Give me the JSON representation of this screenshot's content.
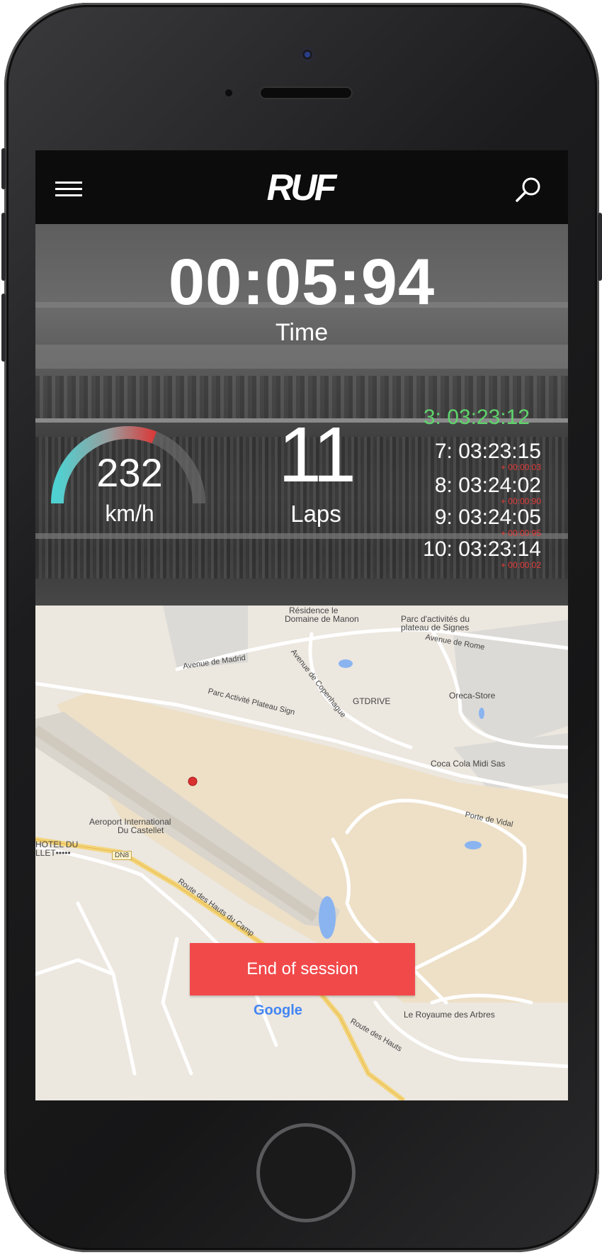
{
  "app": {
    "logo_text": "RUF",
    "menu_icon": "hamburger-menu-icon",
    "search_icon": "search-icon"
  },
  "session": {
    "time": "00:05:94",
    "time_label": "Time",
    "speed": "232",
    "speed_unit": "km/h",
    "speed_gauge_fraction": 0.62,
    "laps": "11",
    "laps_label": "Laps"
  },
  "lap_times": {
    "best": "3: 03:23:12",
    "others": [
      {
        "time": "7: 03:23:15",
        "delta": "+ 00:00:03"
      },
      {
        "time": "8: 03:24:02",
        "delta": "+ 00:00:90"
      },
      {
        "time": "9: 03:24:05",
        "delta": "+ 00:00:95"
      },
      {
        "time": "10: 03:23:14",
        "delta": "+ 00:00:02"
      }
    ]
  },
  "map": {
    "labels": {
      "residence": "Résidence le",
      "residence2": "Domaine de Manon",
      "parc_signes": "Parc d'activités du",
      "parc_signes2": "plateau de Signes",
      "avenue_rome": "Avenue de Rome",
      "avenue_madrid": "Avenue de Madrid",
      "avenue_copenhague": "Avenue de Copenhague",
      "gtdrive": "GTDRIVE",
      "oreca": "Oreca-Store",
      "parc_activite": "Parc Activité Plateau Sign",
      "coca": "Coca Cola Midi Sas",
      "porte_vidal": "Porte de Vidal",
      "aeroport": "Aeroport International",
      "aeroport2": "Du Castellet",
      "hotel": "HOTEL DU",
      "hotel2": "LLET•••••",
      "dn8": "DN8",
      "route_camp": "Route des Hauts du Camp",
      "route_hauts": "Route des Hauts",
      "royaume": "Le Royaume des Arbres"
    },
    "google_logo": "Google"
  },
  "actions": {
    "end_session": "End of session"
  },
  "colors": {
    "best_lap": "#5fd36b",
    "delta": "#e53c3c",
    "end_button": "#f1494a",
    "gauge_start": "#4fd1d1",
    "gauge_end": "#d93a3a"
  }
}
